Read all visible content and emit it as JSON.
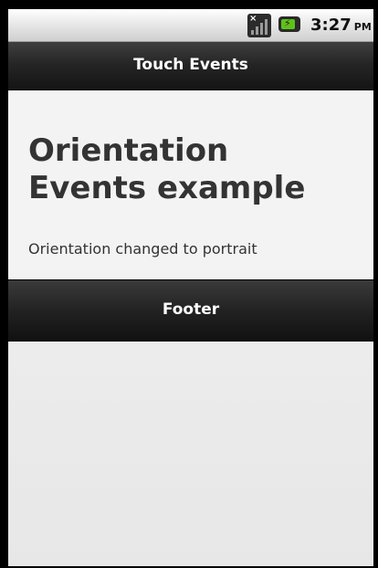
{
  "status_bar": {
    "time": "3:27",
    "ampm": "PM",
    "signal_icon": "signal-no-sim-icon",
    "battery_icon": "battery-charging-icon"
  },
  "header": {
    "title": "Touch Events"
  },
  "content": {
    "heading": "Orientation Events example",
    "status_message": "Orientation changed to portrait"
  },
  "footer": {
    "label": "Footer"
  },
  "colors": {
    "bar_dark": "#1c1c1c",
    "content_bg": "#f3f3f3",
    "text": "#333333",
    "battery_green": "#5fc21a"
  }
}
